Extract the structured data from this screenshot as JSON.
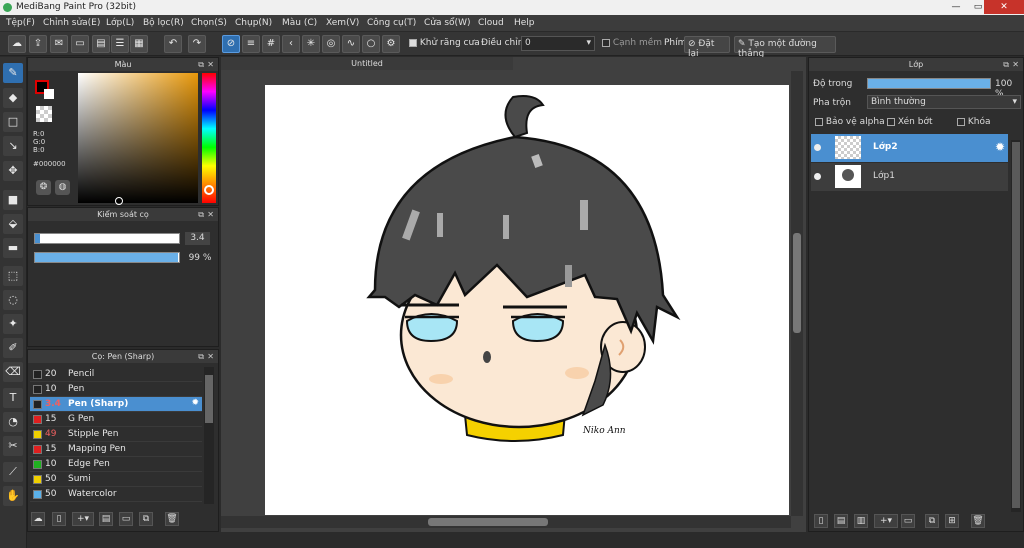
{
  "window": {
    "title": "MediBang Paint Pro (32bit)",
    "minimize": "—",
    "maximize": "▭",
    "close": "✕"
  },
  "menu": [
    "Tệp(F)",
    "Chỉnh sửa(E)",
    "Lớp(L)",
    "Bộ lọc(R)",
    "Chọn(S)",
    "Chụp(N)",
    "Màu (C)",
    "Xem(V)",
    "Công cụ(T)",
    "Cửa sổ(W)",
    "Cloud",
    "Help"
  ],
  "toolbar": {
    "antialias_label": "Khử răng cưa",
    "adjust_label": "Điều chỉnh",
    "adjust_value": "0",
    "edge_label": "Cạnh mềm",
    "key_label": "Phím",
    "reset_label": "Đặt lại",
    "straight_label": "Tạo một đường thẳng"
  },
  "color_panel": {
    "title": "Màu",
    "r": "R:0",
    "g": "G:0",
    "b": "B:0",
    "hex": "#000000",
    "fg_color": "#000000",
    "bg_color": "#ffffff"
  },
  "brush_control": {
    "title": "Kiểm soát cọ",
    "size": "3.4",
    "opacity": "99 %",
    "size_fraction": 0.034,
    "opacity_fraction": 0.99
  },
  "brush_list": {
    "title": "Cọ: Pen (Sharp)",
    "items": [
      {
        "size": "20",
        "name": "Pencil",
        "color": "#222222"
      },
      {
        "size": "10",
        "name": "Pen",
        "color": "#222222"
      },
      {
        "size": "3.4",
        "name": "Pen (Sharp)",
        "color": "#222222",
        "selected": true
      },
      {
        "size": "15",
        "name": "G Pen",
        "color": "#e02020"
      },
      {
        "size": "49",
        "name": "Stipple Pen",
        "color": "#f0d000"
      },
      {
        "size": "15",
        "name": "Mapping Pen",
        "color": "#e02020"
      },
      {
        "size": "10",
        "name": "Edge Pen",
        "color": "#20b020"
      },
      {
        "size": "50",
        "name": "Sumi",
        "color": "#f0d000"
      },
      {
        "size": "50",
        "name": "Watercolor",
        "color": "#5ab0e8"
      }
    ]
  },
  "canvas": {
    "tab_title": "Untitled",
    "signature": "Niko Ann"
  },
  "layer_panel": {
    "title": "Lớp",
    "opacity_label": "Độ trong",
    "opacity_value": "100 %",
    "opacity_fraction": 1.0,
    "blend_label": "Pha trộn",
    "blend_value": "Bình thường",
    "protect_alpha": "Bảo vệ alpha",
    "clipping": "Xén bớt",
    "lock": "Khóa",
    "layers": [
      {
        "name": "Lớp2",
        "selected": true
      },
      {
        "name": "Lớp1",
        "selected": false
      }
    ]
  }
}
